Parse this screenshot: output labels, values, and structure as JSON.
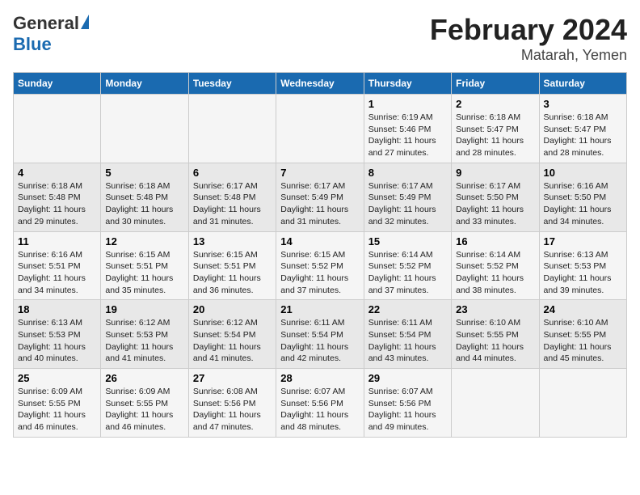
{
  "logo": {
    "general": "General",
    "blue": "Blue"
  },
  "title": "February 2024",
  "location": "Matarah, Yemen",
  "days_of_week": [
    "Sunday",
    "Monday",
    "Tuesday",
    "Wednesday",
    "Thursday",
    "Friday",
    "Saturday"
  ],
  "weeks": [
    [
      {
        "num": "",
        "sunrise": "",
        "sunset": "",
        "daylight": ""
      },
      {
        "num": "",
        "sunrise": "",
        "sunset": "",
        "daylight": ""
      },
      {
        "num": "",
        "sunrise": "",
        "sunset": "",
        "daylight": ""
      },
      {
        "num": "",
        "sunrise": "",
        "sunset": "",
        "daylight": ""
      },
      {
        "num": "1",
        "sunrise": "Sunrise: 6:19 AM",
        "sunset": "Sunset: 5:46 PM",
        "daylight": "Daylight: 11 hours and 27 minutes."
      },
      {
        "num": "2",
        "sunrise": "Sunrise: 6:18 AM",
        "sunset": "Sunset: 5:47 PM",
        "daylight": "Daylight: 11 hours and 28 minutes."
      },
      {
        "num": "3",
        "sunrise": "Sunrise: 6:18 AM",
        "sunset": "Sunset: 5:47 PM",
        "daylight": "Daylight: 11 hours and 28 minutes."
      }
    ],
    [
      {
        "num": "4",
        "sunrise": "Sunrise: 6:18 AM",
        "sunset": "Sunset: 5:48 PM",
        "daylight": "Daylight: 11 hours and 29 minutes."
      },
      {
        "num": "5",
        "sunrise": "Sunrise: 6:18 AM",
        "sunset": "Sunset: 5:48 PM",
        "daylight": "Daylight: 11 hours and 30 minutes."
      },
      {
        "num": "6",
        "sunrise": "Sunrise: 6:17 AM",
        "sunset": "Sunset: 5:48 PM",
        "daylight": "Daylight: 11 hours and 31 minutes."
      },
      {
        "num": "7",
        "sunrise": "Sunrise: 6:17 AM",
        "sunset": "Sunset: 5:49 PM",
        "daylight": "Daylight: 11 hours and 31 minutes."
      },
      {
        "num": "8",
        "sunrise": "Sunrise: 6:17 AM",
        "sunset": "Sunset: 5:49 PM",
        "daylight": "Daylight: 11 hours and 32 minutes."
      },
      {
        "num": "9",
        "sunrise": "Sunrise: 6:17 AM",
        "sunset": "Sunset: 5:50 PM",
        "daylight": "Daylight: 11 hours and 33 minutes."
      },
      {
        "num": "10",
        "sunrise": "Sunrise: 6:16 AM",
        "sunset": "Sunset: 5:50 PM",
        "daylight": "Daylight: 11 hours and 34 minutes."
      }
    ],
    [
      {
        "num": "11",
        "sunrise": "Sunrise: 6:16 AM",
        "sunset": "Sunset: 5:51 PM",
        "daylight": "Daylight: 11 hours and 34 minutes."
      },
      {
        "num": "12",
        "sunrise": "Sunrise: 6:15 AM",
        "sunset": "Sunset: 5:51 PM",
        "daylight": "Daylight: 11 hours and 35 minutes."
      },
      {
        "num": "13",
        "sunrise": "Sunrise: 6:15 AM",
        "sunset": "Sunset: 5:51 PM",
        "daylight": "Daylight: 11 hours and 36 minutes."
      },
      {
        "num": "14",
        "sunrise": "Sunrise: 6:15 AM",
        "sunset": "Sunset: 5:52 PM",
        "daylight": "Daylight: 11 hours and 37 minutes."
      },
      {
        "num": "15",
        "sunrise": "Sunrise: 6:14 AM",
        "sunset": "Sunset: 5:52 PM",
        "daylight": "Daylight: 11 hours and 37 minutes."
      },
      {
        "num": "16",
        "sunrise": "Sunrise: 6:14 AM",
        "sunset": "Sunset: 5:52 PM",
        "daylight": "Daylight: 11 hours and 38 minutes."
      },
      {
        "num": "17",
        "sunrise": "Sunrise: 6:13 AM",
        "sunset": "Sunset: 5:53 PM",
        "daylight": "Daylight: 11 hours and 39 minutes."
      }
    ],
    [
      {
        "num": "18",
        "sunrise": "Sunrise: 6:13 AM",
        "sunset": "Sunset: 5:53 PM",
        "daylight": "Daylight: 11 hours and 40 minutes."
      },
      {
        "num": "19",
        "sunrise": "Sunrise: 6:12 AM",
        "sunset": "Sunset: 5:53 PM",
        "daylight": "Daylight: 11 hours and 41 minutes."
      },
      {
        "num": "20",
        "sunrise": "Sunrise: 6:12 AM",
        "sunset": "Sunset: 5:54 PM",
        "daylight": "Daylight: 11 hours and 41 minutes."
      },
      {
        "num": "21",
        "sunrise": "Sunrise: 6:11 AM",
        "sunset": "Sunset: 5:54 PM",
        "daylight": "Daylight: 11 hours and 42 minutes."
      },
      {
        "num": "22",
        "sunrise": "Sunrise: 6:11 AM",
        "sunset": "Sunset: 5:54 PM",
        "daylight": "Daylight: 11 hours and 43 minutes."
      },
      {
        "num": "23",
        "sunrise": "Sunrise: 6:10 AM",
        "sunset": "Sunset: 5:55 PM",
        "daylight": "Daylight: 11 hours and 44 minutes."
      },
      {
        "num": "24",
        "sunrise": "Sunrise: 6:10 AM",
        "sunset": "Sunset: 5:55 PM",
        "daylight": "Daylight: 11 hours and 45 minutes."
      }
    ],
    [
      {
        "num": "25",
        "sunrise": "Sunrise: 6:09 AM",
        "sunset": "Sunset: 5:55 PM",
        "daylight": "Daylight: 11 hours and 46 minutes."
      },
      {
        "num": "26",
        "sunrise": "Sunrise: 6:09 AM",
        "sunset": "Sunset: 5:55 PM",
        "daylight": "Daylight: 11 hours and 46 minutes."
      },
      {
        "num": "27",
        "sunrise": "Sunrise: 6:08 AM",
        "sunset": "Sunset: 5:56 PM",
        "daylight": "Daylight: 11 hours and 47 minutes."
      },
      {
        "num": "28",
        "sunrise": "Sunrise: 6:07 AM",
        "sunset": "Sunset: 5:56 PM",
        "daylight": "Daylight: 11 hours and 48 minutes."
      },
      {
        "num": "29",
        "sunrise": "Sunrise: 6:07 AM",
        "sunset": "Sunset: 5:56 PM",
        "daylight": "Daylight: 11 hours and 49 minutes."
      },
      {
        "num": "",
        "sunrise": "",
        "sunset": "",
        "daylight": ""
      },
      {
        "num": "",
        "sunrise": "",
        "sunset": "",
        "daylight": ""
      }
    ]
  ]
}
